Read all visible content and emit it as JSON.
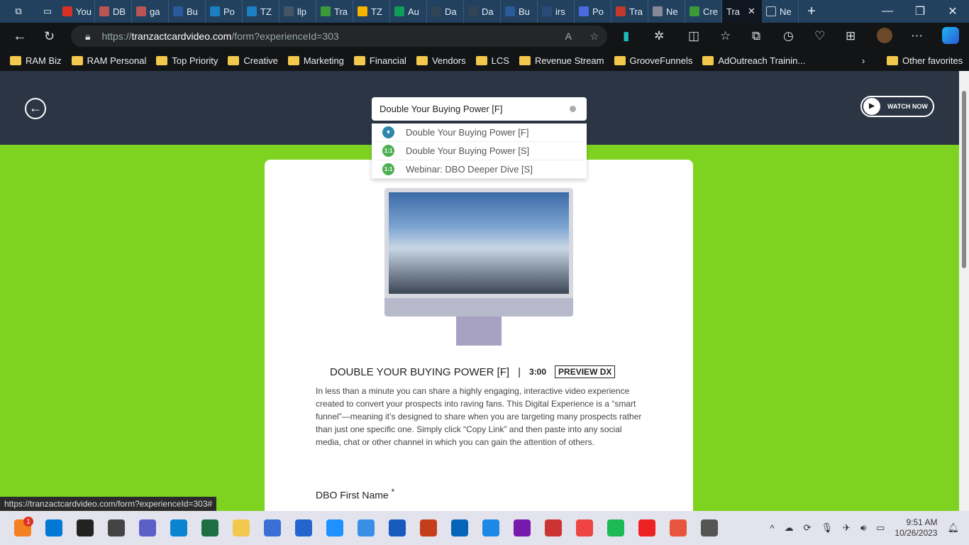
{
  "browser": {
    "tabs": [
      {
        "label": "You",
        "color": "#d93025"
      },
      {
        "label": "DB",
        "color": "#b55"
      },
      {
        "label": "ga",
        "color": "#b55"
      },
      {
        "label": "Bu",
        "color": "#2a5a9a"
      },
      {
        "label": "Po",
        "color": "#1b7fc1"
      },
      {
        "label": "TZ",
        "color": "#1b7fc1"
      },
      {
        "label": "llp",
        "color": "#456"
      },
      {
        "label": "Tra",
        "color": "#3a9a3a"
      },
      {
        "label": "TZ",
        "color": "#f4b400"
      },
      {
        "label": "Au",
        "color": "#0f9d58"
      },
      {
        "label": "Da",
        "color": "#345"
      },
      {
        "label": "Da",
        "color": "#345"
      },
      {
        "label": "Bu",
        "color": "#2a5a9a"
      },
      {
        "label": "irs",
        "color": "#2a4a7a"
      },
      {
        "label": "Po",
        "color": "#4a6ae0"
      },
      {
        "label": "Tra",
        "color": "#c0392b"
      },
      {
        "label": "Ne",
        "color": "#889"
      },
      {
        "label": "Cre",
        "color": "#3a9a3a"
      }
    ],
    "active_tab": "Tra",
    "last_tab": "Ne",
    "url_host": "tranzactcardvideo.com",
    "url_prefix": "https://",
    "url_path": "/form?experienceId=303",
    "bookmarks": [
      "RAM Biz",
      "RAM Personal",
      "Top Priority",
      "Creative",
      "Marketing",
      "Financial",
      "Vendors",
      "LCS",
      "Revenue Stream",
      "GrooveFunnels",
      "AdOutreach Trainin..."
    ],
    "other_favorites": "Other favorites",
    "status_url": "https://tranzactcardvideo.com/form?experienceId=303#"
  },
  "page": {
    "search_value": "Double Your Buying Power [F]",
    "watch_now": "WATCH NOW",
    "dropdown": [
      {
        "icon": "funnel-icon",
        "badge": "▼",
        "color": "#2e86ab",
        "label": "Double Your Buying Power [F]"
      },
      {
        "icon": "one-to-one-icon",
        "badge": "1:1",
        "color": "#4caf50",
        "label": "Double Your Buying Power [S]"
      },
      {
        "icon": "one-to-one-icon",
        "badge": "1:1",
        "color": "#4caf50",
        "label": "Webinar: DBO Deeper Dive [S]"
      }
    ],
    "title": "DOUBLE YOUR BUYING POWER [F]",
    "separator": "|",
    "duration": "3:00",
    "preview": "PREVIEW DX",
    "description": "In less than a minute you can share a highly engaging, interactive video experience created to convert your prospects into raving fans. This Digital Experience is a “smart funnel”—meaning it’s designed to share when you are targeting many prospects rather than just one specific one. Simply click “Copy Link” and then paste into any social media, chat or other channel in which you can gain the attention of others.",
    "field_label": "DBO First Name",
    "required_mark": "*"
  },
  "taskbar": {
    "time": "9:51 AM",
    "date": "10/26/2023",
    "notification_count": "1",
    "apps": [
      "#f4811f",
      "#0078d4",
      "#222",
      "#444",
      "#5b5fc7",
      "#0a84d0",
      "#1d6f42",
      "#f2c94c",
      "#3b6fd6",
      "#2564cf",
      "#1e90ff",
      "#3a8ee6",
      "#185abd",
      "#c43e1c",
      "#0364b8",
      "#1e88e5",
      "#7719aa",
      "#c33",
      "#e44",
      "#1db954",
      "#e22",
      "#e8553d",
      "#555"
    ]
  }
}
